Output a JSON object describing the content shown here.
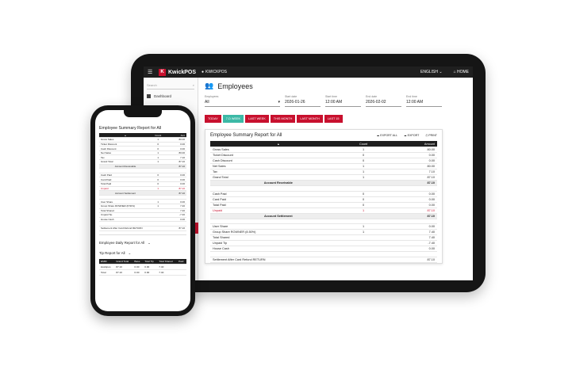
{
  "tablet": {
    "topbar": {
      "menu_icon": "hamburger-icon",
      "logo_letter": "K",
      "brand": "KwickPOS",
      "account": "KWICKPOS",
      "language": "ENGLISH",
      "home": "HOME"
    },
    "sidebar": {
      "search_placeholder": "Search",
      "items": [
        {
          "label": "Dashboard",
          "icon": "grid-icon"
        }
      ]
    },
    "page_title": "Employees",
    "filters": [
      {
        "label": "Employees",
        "value": "All"
      },
      {
        "label": "Start date",
        "value": "2026-01-26"
      },
      {
        "label": "Start time",
        "value": "12:00 AM"
      },
      {
        "label": "End date",
        "value": "2026-02-02"
      },
      {
        "label": "End time",
        "value": "12:00 AM"
      }
    ],
    "range_buttons": [
      "TODAY",
      "7-D WEEK",
      "LAST WEEK",
      "THIS MONTH",
      "LAST MONTH",
      "LAST 15"
    ],
    "active_range": "7-D WEEK",
    "report": {
      "title": "Employee Summary Report for All",
      "actions": [
        "EXPORT ALL",
        "EXPORT",
        "PRINT"
      ],
      "columns": [
        "",
        "Count",
        "Amount"
      ],
      "rows": [
        {
          "label": "Gross Sales",
          "count": "1",
          "amount": "80.00"
        },
        {
          "label": "Ticket Discount",
          "count": "0",
          "amount": "0.00"
        },
        {
          "label": "Cash Discount",
          "count": "0",
          "amount": "0.00"
        },
        {
          "label": "Net Sales",
          "count": "1",
          "amount": "80.00"
        },
        {
          "label": "Tax",
          "count": "1",
          "amount": "7.10"
        },
        {
          "label": "Grand Total",
          "count": "1",
          "amount": "87.10"
        },
        {
          "label": "Account Receivable",
          "count": "",
          "amount": "87.10",
          "type": "section"
        },
        {
          "label": "",
          "count": "",
          "amount": ""
        },
        {
          "label": "Cash Paid",
          "count": "0",
          "amount": "0.00"
        },
        {
          "label": "Card Paid",
          "count": "0",
          "amount": "0.00"
        },
        {
          "label": "Total Paid",
          "count": "0",
          "amount": "0.00"
        },
        {
          "label": "Unpaid",
          "count": "1",
          "amount": "87.10",
          "type": "red"
        },
        {
          "label": "Account Settlement",
          "count": "",
          "amount": "87.10",
          "type": "section"
        },
        {
          "label": "",
          "count": "",
          "amount": ""
        },
        {
          "label": "User Share",
          "count": "1",
          "amount": "0.00"
        },
        {
          "label": "Group Share ROWNER (8.50%)",
          "count": "1",
          "amount": "7.40"
        },
        {
          "label": "Total Shared",
          "count": "",
          "amount": "7.40"
        },
        {
          "label": "Unpaid Tip",
          "count": "",
          "amount": "-7.40"
        },
        {
          "label": "House Cash",
          "count": "",
          "amount": "0.00"
        },
        {
          "label": "",
          "count": "",
          "amount": ""
        },
        {
          "label": "Settlement After Card Refund RETURN",
          "count": "",
          "amount": "87.10"
        }
      ]
    }
  },
  "phone": {
    "summary_title": "Employee Summary Report for All",
    "columns": [
      "",
      "Count",
      "Amt"
    ],
    "rows": [
      {
        "label": "Gross Sales",
        "count": "1",
        "amount": "80.00"
      },
      {
        "label": "Ticket Discount",
        "count": "0",
        "amount": "0.00"
      },
      {
        "label": "Cash Discount",
        "count": "0",
        "amount": "0.00"
      },
      {
        "label": "Net Sales",
        "count": "1",
        "amount": "80.00"
      },
      {
        "label": "Tax",
        "count": "1",
        "amount": "7.10"
      },
      {
        "label": "Grand Total",
        "count": "1",
        "amount": "87.10"
      },
      {
        "label": "Account Receivable",
        "count": "",
        "amount": "87.10",
        "type": "section"
      },
      {
        "label": "",
        "count": "",
        "amount": ""
      },
      {
        "label": "Cash Paid",
        "count": "0",
        "amount": "0.00"
      },
      {
        "label": "Card Paid",
        "count": "0",
        "amount": "0.00"
      },
      {
        "label": "Total Paid",
        "count": "0",
        "amount": "0.00"
      },
      {
        "label": "Unpaid",
        "count": "1",
        "amount": "87.10",
        "type": "red"
      },
      {
        "label": "Account Settlement",
        "count": "",
        "amount": "87.10",
        "type": "section"
      },
      {
        "label": "",
        "count": "",
        "amount": ""
      },
      {
        "label": "User Share",
        "count": "1",
        "amount": "0.00"
      },
      {
        "label": "Group Share ROWNER (8.50%)",
        "count": "1",
        "amount": "7.40"
      },
      {
        "label": "Total Shared",
        "count": "",
        "amount": "7.40"
      },
      {
        "label": "Unpaid Tip",
        "count": "",
        "amount": "-7.40"
      },
      {
        "label": "House Cash",
        "count": "",
        "amount": "0.00"
      },
      {
        "label": "",
        "count": "",
        "amount": ""
      },
      {
        "label": "Settlement After Card Refund RETURN",
        "count": "",
        "amount": "87.10"
      }
    ],
    "daily_title": "Employee Daily Report for All",
    "tip_title": "Tip Report for All",
    "tip_columns": [
      "EMID",
      "Grand Total",
      "Base",
      "Total Tip",
      "Total Shared",
      "Paid"
    ],
    "tip_rows": [
      [
        "kwickpos",
        "87.10",
        "0.00",
        "0.00",
        "7.40",
        ""
      ],
      [
        "Total",
        "87.10",
        "0.00",
        "0.00",
        "7.40",
        ""
      ]
    ]
  }
}
